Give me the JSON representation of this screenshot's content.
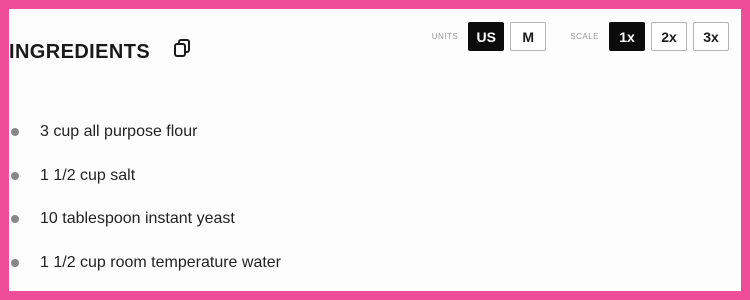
{
  "ingredients": {
    "title": "INGREDIENTS",
    "units_label": "UNITS",
    "scale_label": "SCALE",
    "units": [
      {
        "label": "US",
        "active": true
      },
      {
        "label": "M",
        "active": false
      }
    ],
    "scale": [
      {
        "label": "1x",
        "active": true
      },
      {
        "label": "2x",
        "active": false
      },
      {
        "label": "3x",
        "active": false
      }
    ],
    "items": [
      "3 cup all purpose flour",
      "1 1/2 cup salt",
      "10 tablespoon instant yeast",
      "1 1/2 cup room temperature water"
    ]
  },
  "colors": {
    "border": "#ef4c9a",
    "active_button": "#0b0b0b"
  },
  "icons": {
    "copy": "copy-icon"
  }
}
